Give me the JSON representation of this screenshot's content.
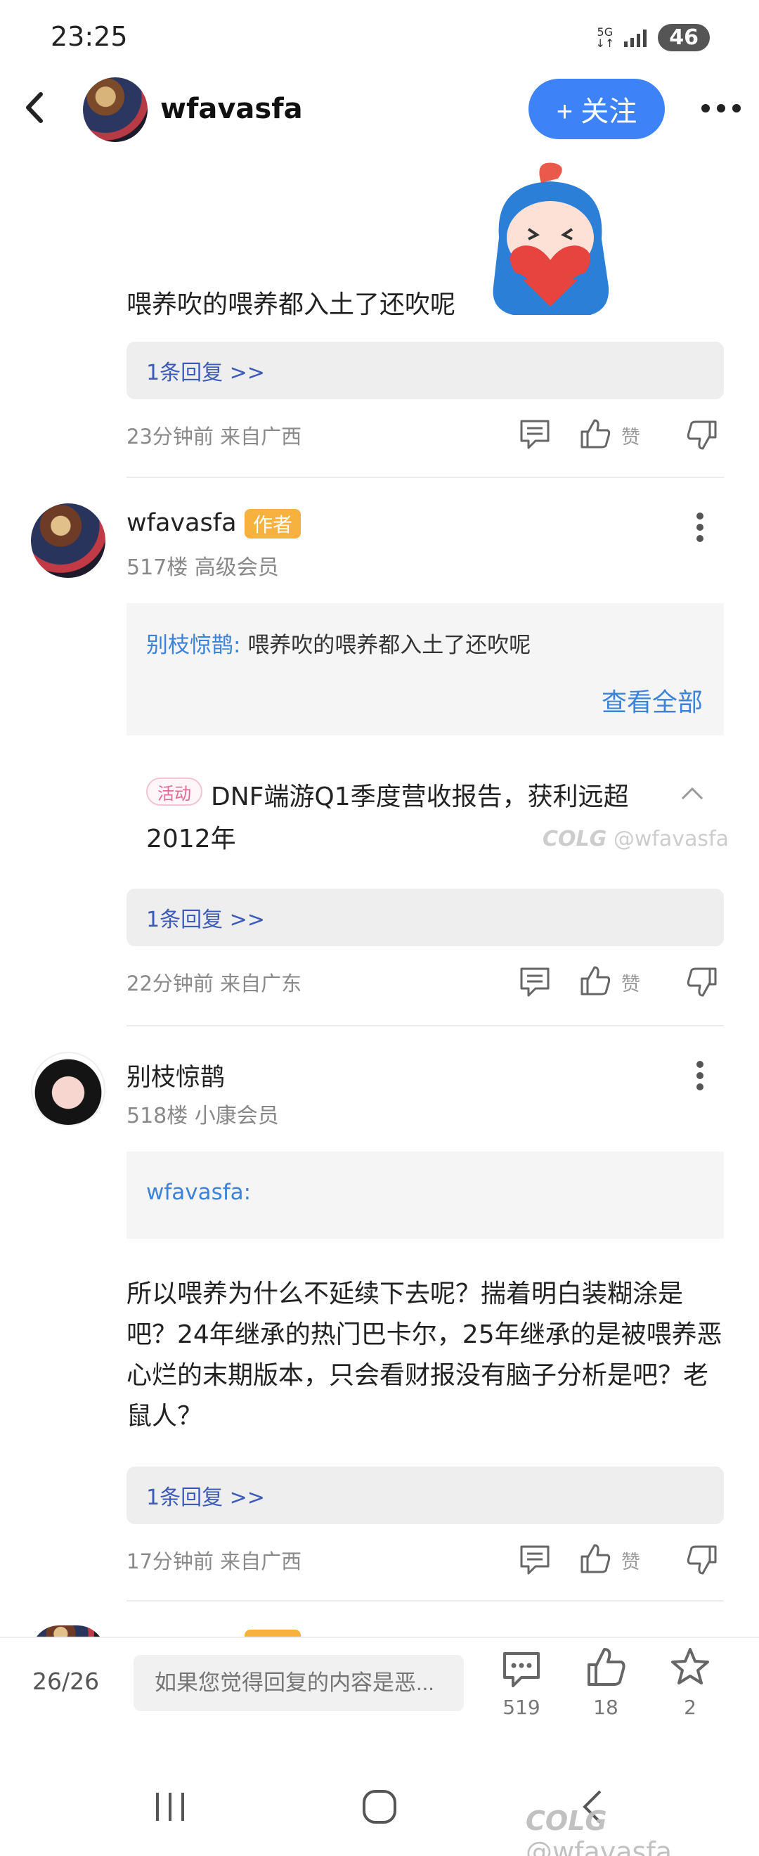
{
  "status": {
    "time": "23:25",
    "network": "5G",
    "battery": "46"
  },
  "header": {
    "username": "wfavasfa",
    "follow_label": "+ 关注"
  },
  "comment1": {
    "text": "喂养吹的喂养都入土了还吹呢",
    "replies": "1条回复 >>",
    "meta": "23分钟前 来自广西",
    "like_label": "赞"
  },
  "comment2": {
    "username": "wfavasfa",
    "badge": "作者",
    "floor": "517楼 高级会员",
    "quote_user": "别枝惊鹊:",
    "quote_text": "喂养吹的喂养都入土了还吹呢",
    "see_all": "查看全部",
    "activity_tag": "活动",
    "text_line1": "DNF端游Q1季度营收报告，获利远超",
    "text_line2": "2012年",
    "watermark": "@wfavasfa",
    "replies": "1条回复 >>",
    "meta": "22分钟前 来自广东",
    "like_label": "赞"
  },
  "comment3": {
    "username": "别枝惊鹊",
    "floor": "518楼 小康会员",
    "quote_user": "wfavasfa:",
    "text": "所以喂养为什么不延续下去呢？揣着明白装糊涂是吧？24年继承的热门巴卡尔，25年继承的是被喂养恶心烂的末期版本，只会看财报没有脑子分析是吧？老鼠人？",
    "replies": "1条回复 >>",
    "meta": "17分钟前 来自广西",
    "like_label": "赞"
  },
  "bottom": {
    "page": "26/26",
    "input_placeholder": "如果您觉得回复的内容是恶...",
    "comments_count": "519",
    "likes_count": "18",
    "favorites_count": "2",
    "watermark": "@wfavasfa"
  },
  "colors": {
    "accent": "#3d83f7",
    "link": "#3d83d8",
    "badge": "#f6b13f"
  }
}
